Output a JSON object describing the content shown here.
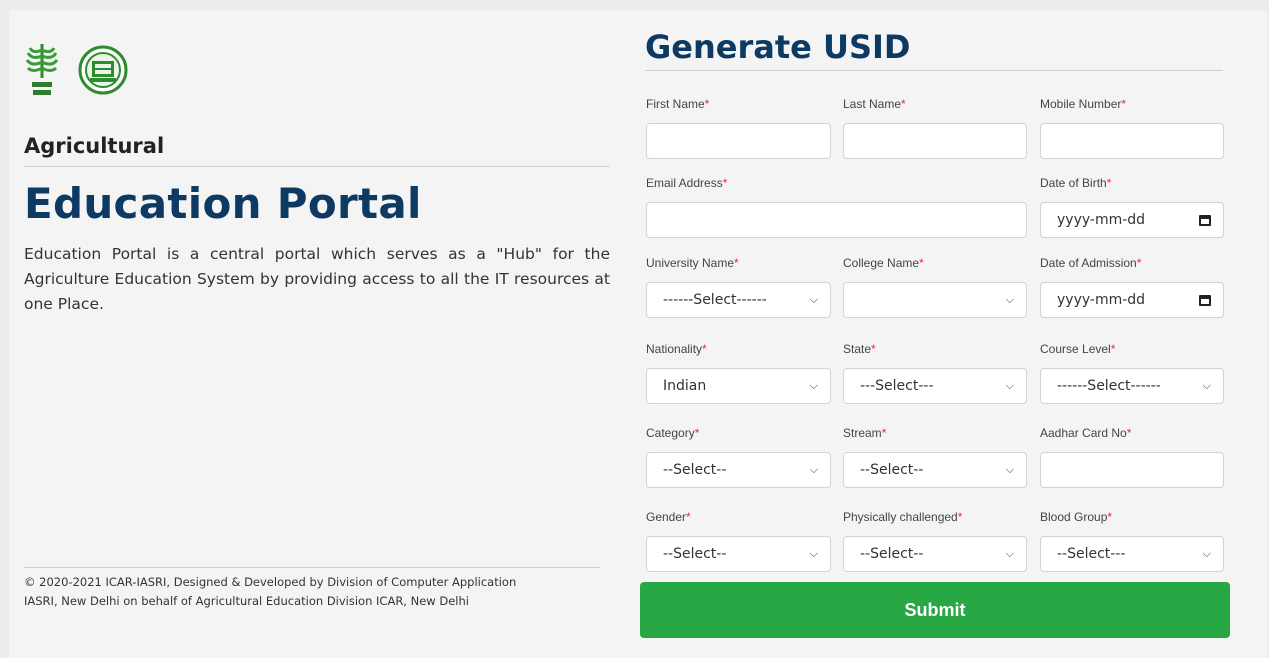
{
  "left": {
    "subtitle": "Agricultural",
    "title": "Education Portal",
    "description": "Education Portal is a central portal which serves as a \"Hub\" for the Agriculture Education System by providing access to all the IT resources at one Place.",
    "footer_line1": "© 2020-2021 ICAR-IASRI, Designed & Developed by Division of Computer Application",
    "footer_line2": "IASRI, New Delhi on behalf of Agricultural Education Division ICAR, New Delhi"
  },
  "form": {
    "title": "Generate USID",
    "required_mark": "*",
    "fields": {
      "first_name": {
        "label": "First Name",
        "value": ""
      },
      "last_name": {
        "label": "Last Name",
        "value": ""
      },
      "mobile": {
        "label": "Mobile Number",
        "value": ""
      },
      "email": {
        "label": "Email Address",
        "value": ""
      },
      "dob": {
        "label": "Date of Birth",
        "placeholder": "yyyy-mm-dd"
      },
      "university": {
        "label": "University Name",
        "selected": "------Select------"
      },
      "college": {
        "label": "College Name",
        "selected": ""
      },
      "admission": {
        "label": "Date of Admission",
        "placeholder": "yyyy-mm-dd"
      },
      "nationality": {
        "label": "Nationality",
        "selected": "Indian"
      },
      "state": {
        "label": "State",
        "selected": "---Select---"
      },
      "course_level": {
        "label": "Course Level",
        "selected": "------Select------"
      },
      "category": {
        "label": "Category",
        "selected": "--Select--"
      },
      "stream": {
        "label": "Stream",
        "selected": "--Select--"
      },
      "aadhar": {
        "label": "Aadhar Card No",
        "value": ""
      },
      "gender": {
        "label": "Gender",
        "selected": "--Select--"
      },
      "physically": {
        "label": "Physically challenged",
        "selected": "--Select--"
      },
      "blood": {
        "label": "Blood Group",
        "selected": "--Select---"
      }
    },
    "submit_label": "Submit"
  },
  "colors": {
    "title": "#0d3a63",
    "submit": "#28a745",
    "required": "#dd3333"
  },
  "icons": {
    "logo1": "icar-wheat-logo",
    "logo2": "seal-logo",
    "select": "chevron-down-icon",
    "date": "calendar-icon"
  }
}
